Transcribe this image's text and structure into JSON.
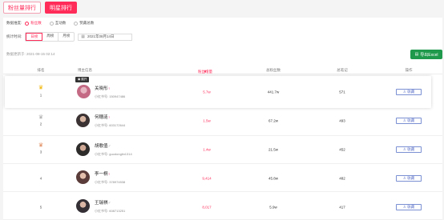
{
  "tabs": [
    {
      "label": "粉丝量排行",
      "active": false
    },
    {
      "label": "明星排行",
      "active": true
    }
  ],
  "filters": {
    "data_type_label": "数据维度:",
    "data_types": [
      {
        "label": "粉丝数",
        "selected": true
      },
      {
        "label": "互动数",
        "selected": false
      },
      {
        "label": "赞藏总数",
        "selected": false
      }
    ],
    "period_label": "统计时间:",
    "periods": [
      {
        "label": "日榜",
        "selected": true
      },
      {
        "label": "周榜",
        "selected": false
      },
      {
        "label": "月榜",
        "selected": false
      }
    ],
    "date_value": "2021年08月14日"
  },
  "updated_text": "数据更新于: 2021-08-15 02:14",
  "export_label": "导出Excel",
  "columns": {
    "rank": "排名",
    "blogger": "博主信息",
    "fans_inc": "粉丝增量",
    "fans_total": "总粉丝数",
    "notes": "总笔记",
    "action": "操作"
  },
  "rows": [
    {
      "rank": "1",
      "crown": "gold",
      "name": "关晓彤",
      "gender": "♀",
      "account": "小红书号: 150947486",
      "fans_inc": "5.7w",
      "fans_total": "441.7w",
      "notes": "571",
      "action": "收藏",
      "avatar": "#c46a84"
    },
    {
      "rank": "2",
      "crown": "silver",
      "name": "何穗涟",
      "gender": "♀",
      "account": "小红书号: 603172644",
      "fans_inc": "1.5w",
      "fans_total": "67.2w",
      "notes": "493",
      "action": "收藏",
      "avatar": "#3b3333"
    },
    {
      "rank": "3",
      "crown": "bronze",
      "name": "胡歌值",
      "gender": "♂",
      "account": "小红书号: guodonglin1314",
      "fans_inc": "1.4w",
      "fans_total": "21.5w",
      "notes": "452",
      "action": "收藏",
      "avatar": "#2e2b2b"
    },
    {
      "rank": "4",
      "crown": "",
      "name": "李一桐",
      "gender": "♀",
      "account": "小红书号: 378974538",
      "fans_inc": "9,414",
      "fans_total": "45.8w",
      "notes": "482",
      "action": "收藏",
      "avatar": "#5a3d3a"
    },
    {
      "rank": "5",
      "crown": "",
      "name": "王瑞祺",
      "gender": "♂",
      "account": "小红书号: 608713251",
      "fans_inc": "8,017",
      "fans_total": "5.9w",
      "notes": "417",
      "action": "收藏",
      "avatar": "#332f35"
    }
  ],
  "colors": {
    "accent": "#ff2c5a",
    "export": "#1f9a4c",
    "action_border": "#7b8fd3"
  }
}
